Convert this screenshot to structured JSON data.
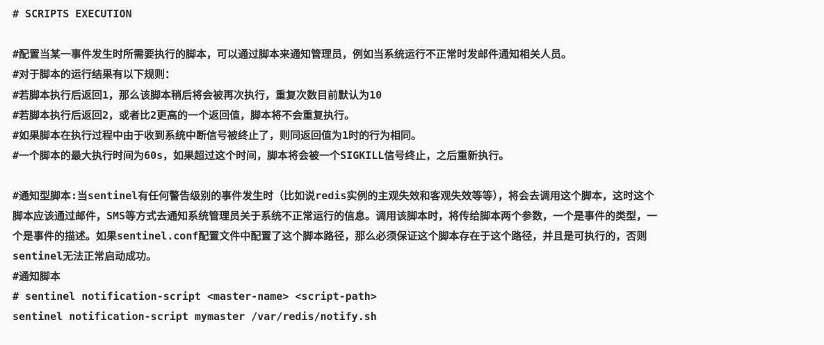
{
  "doc": {
    "heading": "# SCRIPTS EXECUTION",
    "para1": [
      "#配置当某一事件发生时所需要执行的脚本，可以通过脚本来通知管理员，例如当系统运行不正常时发邮件通知相关人员。",
      "#对于脚本的运行结果有以下规则：",
      "#若脚本执行后返回1，那么该脚本稍后将会被再次执行，重复次数目前默认为10",
      "#若脚本执行后返回2，或者比2更高的一个返回值，脚本将不会重复执行。",
      "#如果脚本在执行过程中由于收到系统中断信号被终止了，则同返回值为1时的行为相同。",
      "#一个脚本的最大执行时间为60s，如果超过这个时间，脚本将会被一个SIGKILL信号终止，之后重新执行。"
    ],
    "para2": [
      "#通知型脚本:当sentinel有任何警告级别的事件发生时（比如说redis实例的主观失效和客观失效等等），将会去调用这个脚本，这时这个",
      "脚本应该通过邮件，SMS等方式去通知系统管理员关于系统不正常运行的信息。调用该脚本时，将传给脚本两个参数，一个是事件的类型，一",
      "个是事件的描述。如果sentinel.conf配置文件中配置了这个脚本路径，那么必须保证这个脚本存在于这个路径，并且是可执行的，否则",
      "sentinel无法正常启动成功。",
      "#通知脚本"
    ],
    "code_comment": "# sentinel notification-script <master-name> <script-path>",
    "code_line": "sentinel notification-script mymaster /var/redis/notify.sh"
  }
}
